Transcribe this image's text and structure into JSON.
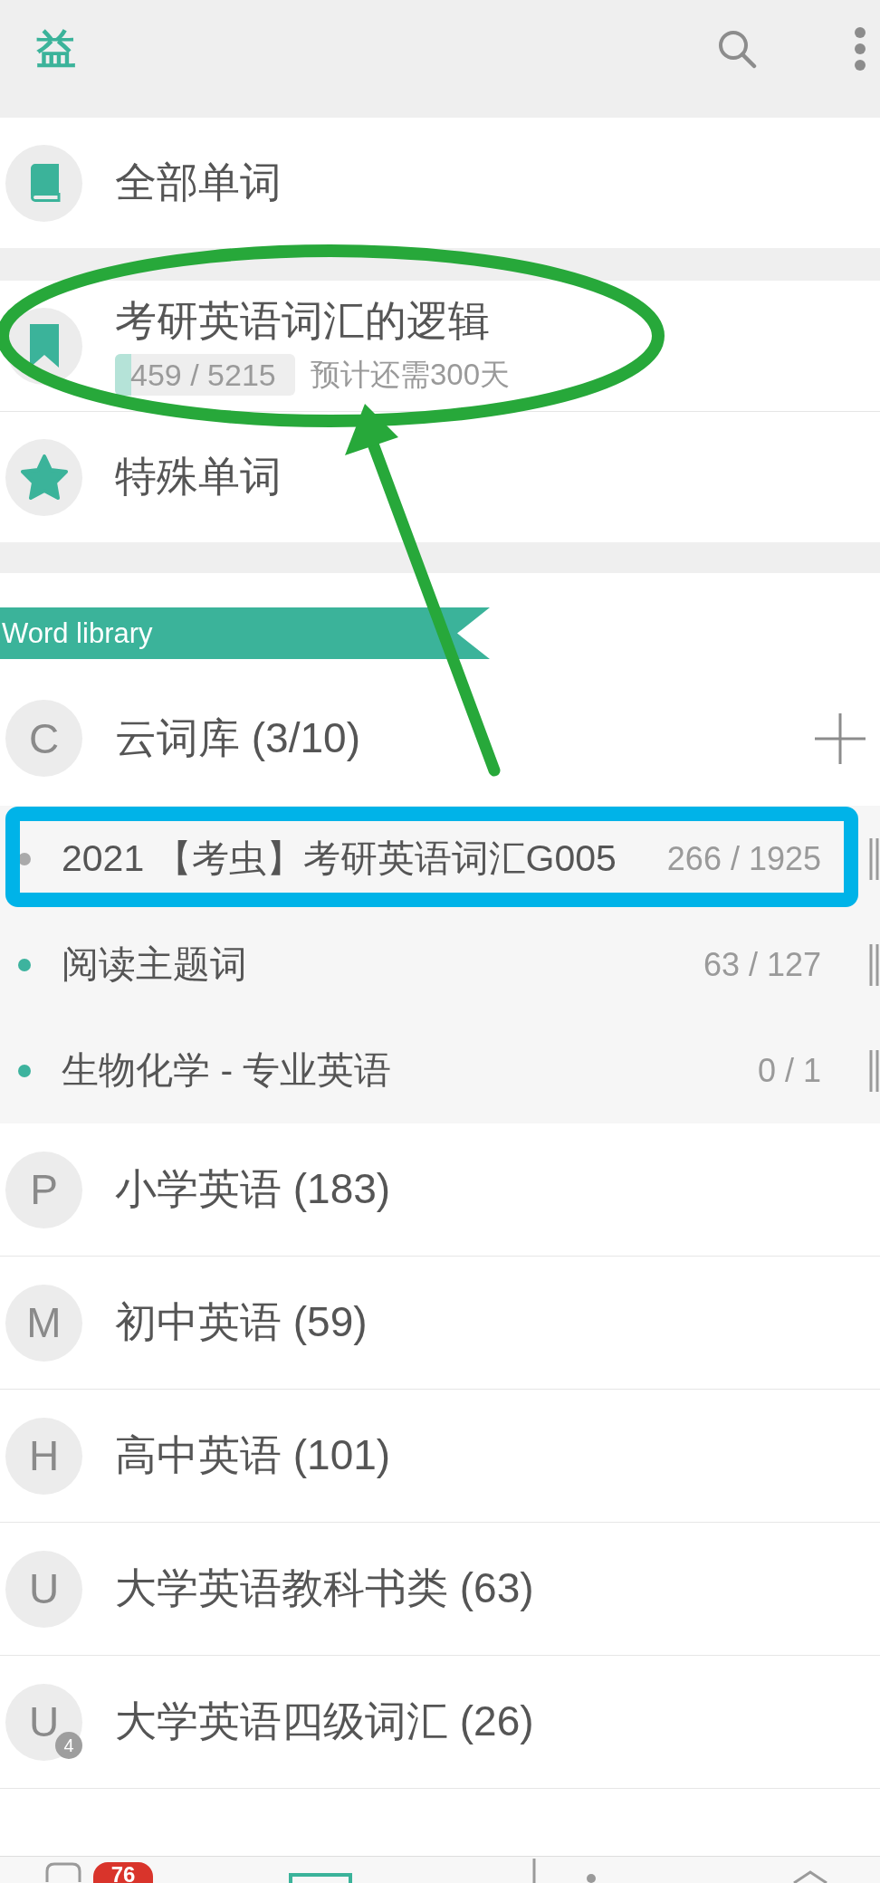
{
  "header": {
    "title": "益"
  },
  "top_groups": [
    {
      "items": [
        {
          "kind": "book",
          "title": "全部单词"
        }
      ]
    },
    {
      "items": [
        {
          "kind": "bookmark",
          "title": "考研英语词汇的逻辑",
          "progress": {
            "label": "459 / 5215",
            "level": 0.088
          },
          "estimate": "预计还需300天"
        },
        {
          "kind": "star",
          "title": "特殊单词"
        }
      ]
    }
  ],
  "word_library": {
    "banner": "Word library",
    "groups": [
      {
        "letter": "C",
        "title": "云词库 (3/10)",
        "add_button": true,
        "books": [
          {
            "title": "2021 【考虫】考研英语词汇G005",
            "count": "266 / 1925",
            "color": "#aaaaaa"
          },
          {
            "title": "阅读主题词",
            "count": "63 / 127",
            "color": "#3db39e"
          },
          {
            "title": "生物化学 - 专业英语",
            "count": "0 / 1",
            "color": "#3db39e"
          }
        ]
      },
      {
        "letter": "P",
        "title": "小学英语 (183)",
        "add_button": false
      },
      {
        "letter": "M",
        "title": "初中英语 (59)",
        "add_button": false
      },
      {
        "letter": "H",
        "title": "高中英语 (101)",
        "add_button": false
      },
      {
        "letter": "U",
        "title": "大学英语教科书类 (63)",
        "add_button": false
      },
      {
        "letter": "U",
        "title": "大学英语四级词汇 (26)",
        "add_button": false,
        "badge": "4"
      }
    ]
  },
  "bottom_nav": [
    {
      "kind": "chat",
      "selected": false,
      "badge": "76"
    },
    {
      "kind": "cards",
      "selected": true
    },
    {
      "kind": "stats",
      "selected": false
    },
    {
      "kind": "home",
      "selected": false
    }
  ],
  "annotations": [
    {
      "kind": "ellipse"
    },
    {
      "kind": "arrow"
    },
    {
      "kind": "frame"
    }
  ]
}
